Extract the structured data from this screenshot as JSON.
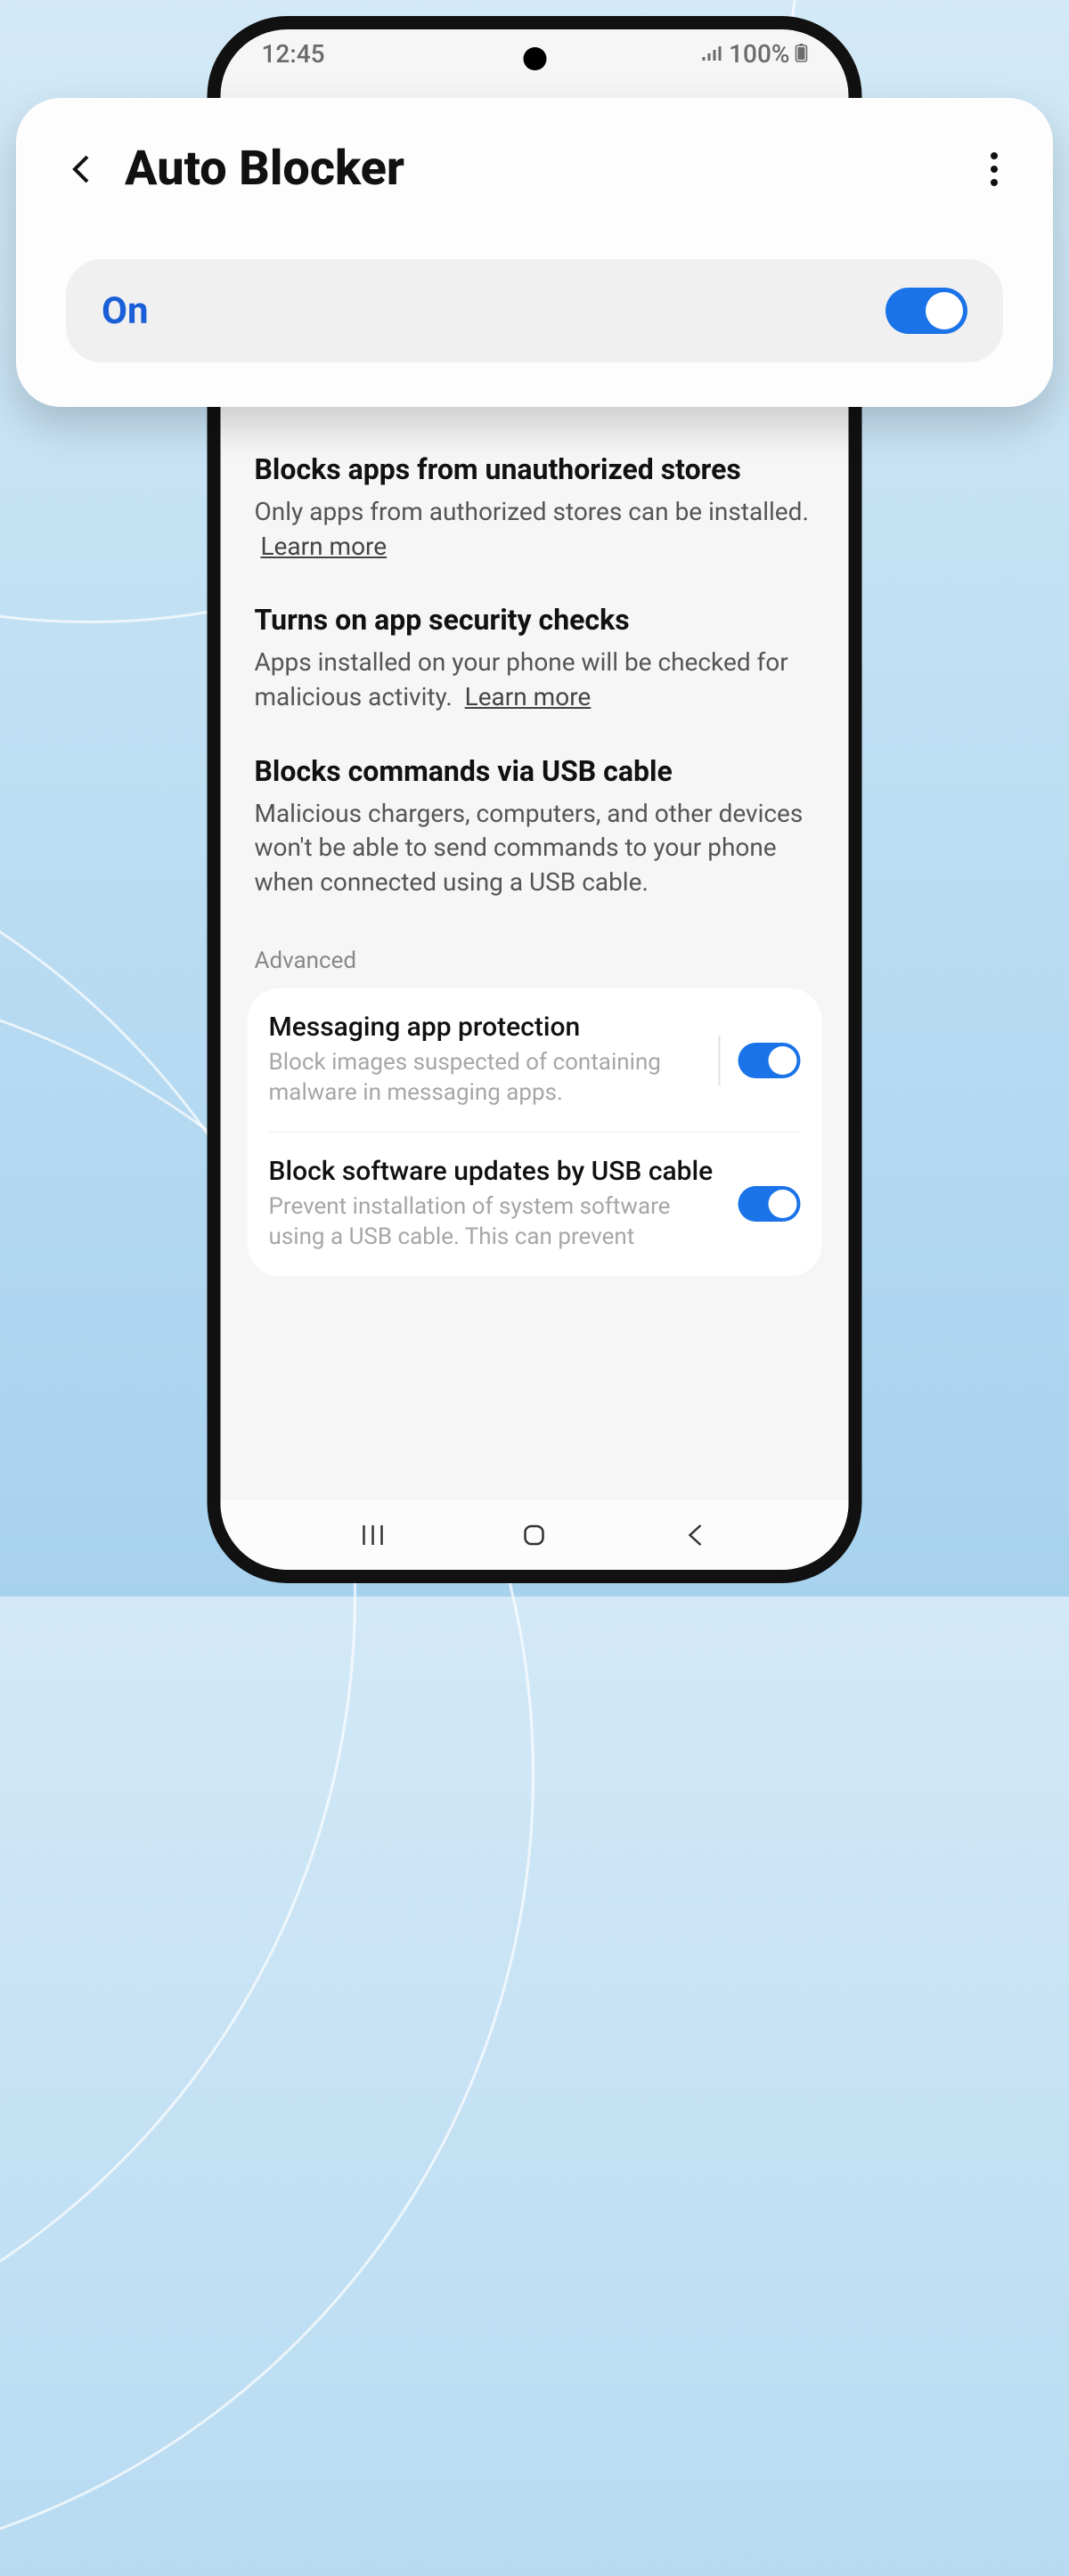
{
  "status": {
    "time": "12:45",
    "signal": "⫴",
    "battery_pct": "100%",
    "battery_icon": "▮"
  },
  "header": {
    "title": "Auto Blocker",
    "state_label": "On"
  },
  "sections": [
    {
      "title": "Blocks apps from unauthorized stores",
      "body": "Only apps from authorized stores can be installed.",
      "learn_more": "Learn more"
    },
    {
      "title": "Turns on app security checks",
      "body": "Apps installed on your phone will be checked for malicious activity.",
      "learn_more": "Learn more"
    },
    {
      "title": "Blocks commands via USB cable",
      "body": "Malicious chargers, computers, and other devices won't be able to send commands to your phone when connected using a USB cable."
    }
  ],
  "advanced_label": "Advanced",
  "advanced_options": [
    {
      "title": "Messaging app protection",
      "sub": "Block images suspected of containing malware in messaging apps.",
      "on": true
    },
    {
      "title": "Block software updates by USB cable",
      "sub": "Prevent installation of system software using a USB cable. This can prevent",
      "on": true
    }
  ]
}
